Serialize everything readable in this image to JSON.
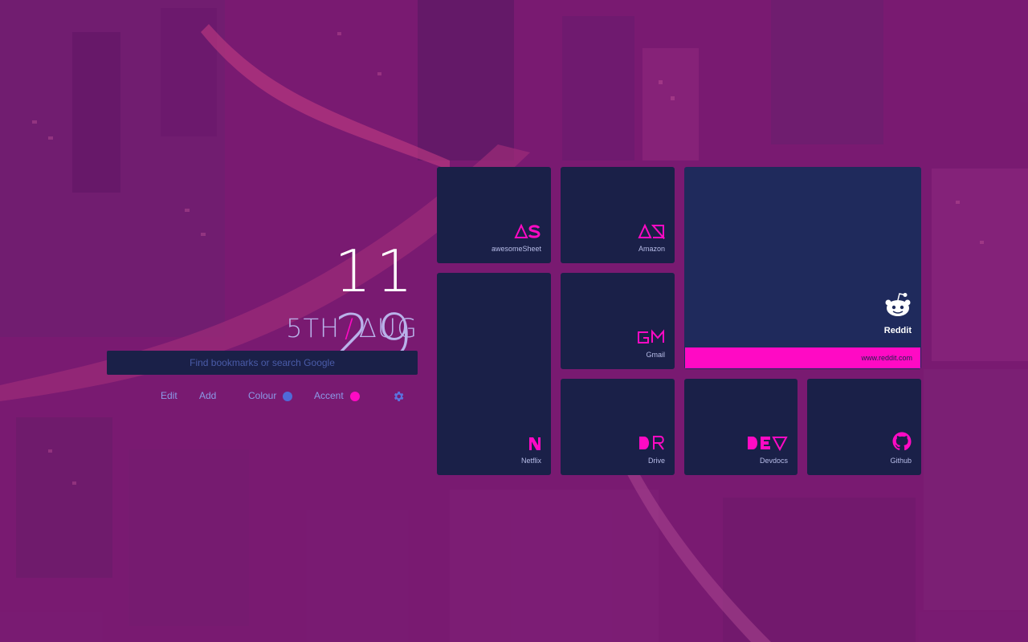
{
  "clock": {
    "hours": "11",
    "minutes": "29"
  },
  "date": {
    "day": "5TH",
    "separator": "/",
    "month": "ΔUG"
  },
  "search": {
    "placeholder": "Find bookmarks or search Google"
  },
  "controls": {
    "edit": "Edit",
    "add": "Add",
    "colour": "Colour",
    "accent": "Accent",
    "colour_value": "#4f6bd8",
    "accent_value": "#ff0ac4"
  },
  "bookmarks": [
    {
      "name": "awesomeSheet",
      "logo": "ΔS"
    },
    {
      "name": "Amazon",
      "logo": "ΔZ"
    },
    {
      "name": "Reddit",
      "logo": "reddit-alien-icon",
      "url": "www.reddit.com"
    },
    {
      "name": "Netflix",
      "logo": "N"
    },
    {
      "name": "Gmail",
      "logo": "GM"
    },
    {
      "name": "Drive",
      "logo": "DR"
    },
    {
      "name": "Devdocs",
      "logo": "DEV"
    },
    {
      "name": "Github",
      "logo": "github-octocat-icon"
    }
  ],
  "colors": {
    "accent": "#ff0ac4",
    "tile": "#1a2048",
    "tile_highlight": "#1f2a5c",
    "muted_text": "#8c9ae8"
  }
}
